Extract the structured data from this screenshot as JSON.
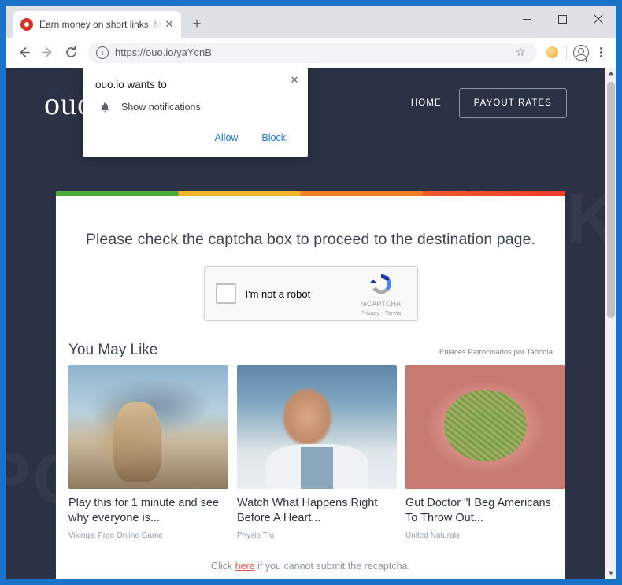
{
  "browser": {
    "tab": {
      "title": "Earn money on short links. Make",
      "favicon": "record-icon",
      "close_label": "✕"
    },
    "new_tab_label": "+",
    "window_controls": {
      "minimize": "minimize-icon",
      "maximize": "maximize-icon",
      "close": "close-icon"
    },
    "toolbar": {
      "back": "back-arrow-icon",
      "forward": "forward-arrow-icon",
      "reload": "reload-icon",
      "site_info": "i",
      "url_scheme": "https://",
      "url_rest": "ouo.io/yaYcnB",
      "bookmark": "star-icon",
      "extension": "extension-icon",
      "profile": "profile-icon",
      "menu": "kebab-menu-icon"
    }
  },
  "notification": {
    "title": "ouo.io wants to",
    "option": "Show notifications",
    "icon": "bell-icon",
    "close": "✕",
    "allow_label": "Allow",
    "block_label": "Block"
  },
  "site": {
    "logo": "ouo",
    "nav": {
      "home": "HOME",
      "payout_rates": "PAYOUT RATES"
    },
    "heading": "Please check the captcha box to proceed to the destination page.",
    "recaptcha": {
      "label": "I'm not a robot",
      "brand": "reCAPTCHA",
      "terms": "Privacy - Terms",
      "logo_icon": "recaptcha-logo-icon"
    },
    "taboola": {
      "title": "You May Like",
      "credit": "Enlaces Patrocinados por Taboola",
      "items": [
        {
          "caption": "Play this for 1 minute and see why everyone is...",
          "source": "Vikings: Free Online Game",
          "image": "warrior-woman-with-shark-image"
        },
        {
          "caption": "Watch What Happens Right Before A Heart...",
          "source": "Physio Tru",
          "image": "older-man-portrait-image"
        },
        {
          "caption": "Gut Doctor \"I Beg Americans To Throw Out...",
          "source": "United Naturals",
          "image": "intestine-illustration-image"
        }
      ]
    },
    "footer": {
      "prefix": "Click ",
      "link": "here",
      "suffix": " if you cannot submit the recaptcha."
    },
    "watermark": "PCRISK"
  },
  "colors": {
    "chrome_tabstrip": "#dee1e6",
    "page_background": "#2b3245",
    "accent_link": "#1a73e8",
    "card_stripe_green": "#49a942",
    "card_stripe_yellow": "#f0b726",
    "card_stripe_orange": "#f07e26",
    "card_stripe_red": "#ee3b2e"
  }
}
